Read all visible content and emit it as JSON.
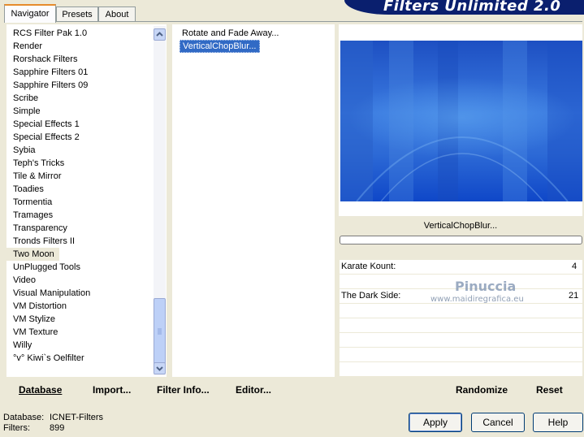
{
  "tabs": [
    {
      "label": "Navigator",
      "active": true
    },
    {
      "label": "Presets",
      "active": false
    },
    {
      "label": "About",
      "active": false
    }
  ],
  "banner": {
    "title": "Filters Unlimited 2.0"
  },
  "categories": [
    "RCS Filter Pak 1.0",
    "Render",
    "Rorshack Filters",
    "Sapphire Filters 01",
    "Sapphire Filters 09",
    "Scribe",
    "Simple",
    "Special Effects 1",
    "Special Effects 2",
    "Sybia",
    "Teph's Tricks",
    "Tile & Mirror",
    "Toadies",
    "Tormentia",
    "Tramages",
    "Transparency",
    "Tronds Filters II",
    "Two Moon",
    "UnPlugged Tools",
    "Video",
    "Visual Manipulation",
    "VM Distortion",
    "VM Stylize",
    "VM Texture",
    "Willy",
    "°v° Kiwi`s Oelfilter"
  ],
  "selected_category": "Two Moon",
  "filters": [
    "Rotate and Fade Away...",
    "VerticalChopBlur..."
  ],
  "selected_filter": "VerticalChopBlur...",
  "preview": {
    "filter_name": "VerticalChopBlur...",
    "watermark": "Pinuccia",
    "watermark_url": "www.maidiregrafica.eu"
  },
  "params": [
    {
      "label": "Karate Kount:",
      "value": "4"
    },
    {
      "label": "The Dark Side:",
      "value": "21"
    }
  ],
  "left_buttons": {
    "database": "Database",
    "import": "Import...",
    "filter_info": "Filter Info...",
    "editor": "Editor..."
  },
  "right_buttons": {
    "randomize": "Randomize",
    "reset": "Reset"
  },
  "status": {
    "database_label": "Database:",
    "database_value": "ICNET-Filters",
    "filters_label": "Filters:",
    "filters_value": "899"
  },
  "dialog_buttons": {
    "apply": "Apply",
    "cancel": "Cancel",
    "help": "Help"
  },
  "colors": {
    "selection": "#316ac5",
    "banner": "#0a1f6e",
    "tab_accent": "#e68b2c"
  }
}
